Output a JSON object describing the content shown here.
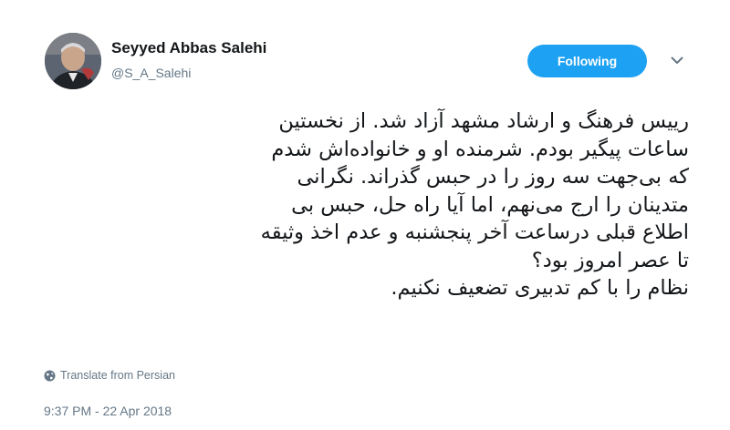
{
  "profile": {
    "display_name": "Seyyed Abbas Salehi",
    "handle": "@S_A_Salehi"
  },
  "follow_button": {
    "label": "Following",
    "color": "#1da1f2"
  },
  "menu": {
    "icon": "chevron-down-icon"
  },
  "tweet": {
    "lines": [
      "رییس فرهنگ و ارشاد مشهد آزاد شد. از نخستین",
      "ساعات پیگیر بودم. شرمنده او و خانواده‌اش شدم",
      "که بی‌جهت سه روز را در حبس گذراند. نگرانی",
      "متدینان  را ارج می‌نهم، اما آیا راه حل، حبس بی",
      "اطلاع قبلی درساعت آخر پنجشنبه و عدم اخذ وثیقه",
      "تا عصر امروز بود؟",
      "نظام را با کم تدبیری تضعیف نکنیم."
    ]
  },
  "translate": {
    "label": "Translate from Persian",
    "icon": "globe-icon"
  },
  "timestamp": "9:37 PM - 22 Apr 2018"
}
